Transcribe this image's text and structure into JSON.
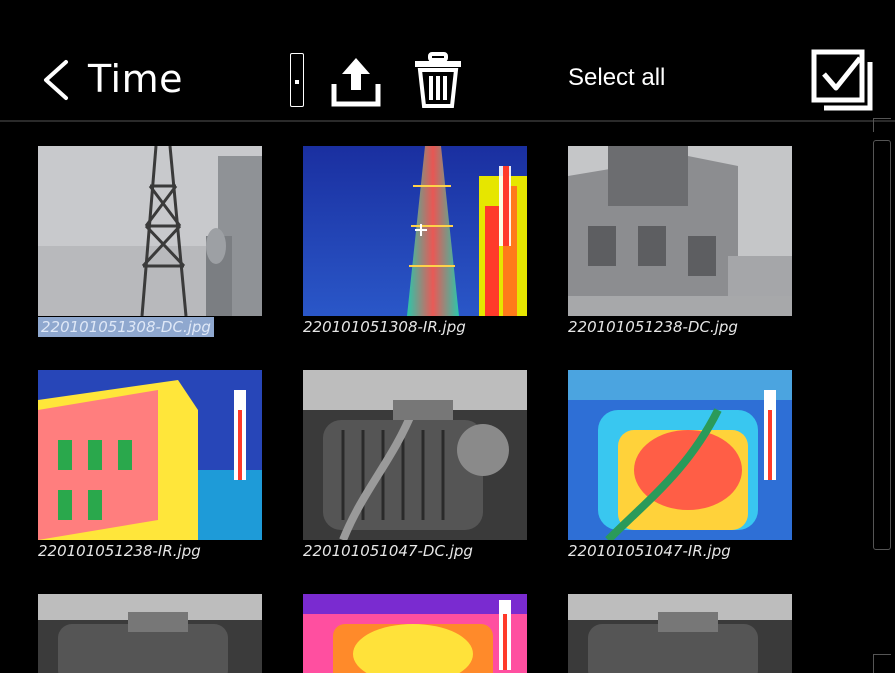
{
  "header": {
    "title": "Time",
    "select_all_label": "Select all"
  },
  "icons": {
    "back": "chevron-left-icon",
    "upload": "upload-icon",
    "delete": "trash-icon",
    "select": "checkbox-checked-icon"
  },
  "colors": {
    "background": "#000000",
    "selection_highlight": "#8fa8cf",
    "text": "#ffffff"
  },
  "files": [
    {
      "name": "220101051308-DC.jpg",
      "type": "DC",
      "selected": true
    },
    {
      "name": "220101051308-IR.jpg",
      "type": "IR",
      "selected": false
    },
    {
      "name": "220101051238-DC.jpg",
      "type": "DC",
      "selected": false
    },
    {
      "name": "220101051238-IR.jpg",
      "type": "IR",
      "selected": false
    },
    {
      "name": "220101051047-DC.jpg",
      "type": "DC",
      "selected": false
    },
    {
      "name": "220101051047-IR.jpg",
      "type": "IR",
      "selected": false
    },
    {
      "name": "",
      "type": "DC",
      "selected": false
    },
    {
      "name": "",
      "type": "IR",
      "selected": false
    },
    {
      "name": "",
      "type": "DC",
      "selected": false
    }
  ]
}
